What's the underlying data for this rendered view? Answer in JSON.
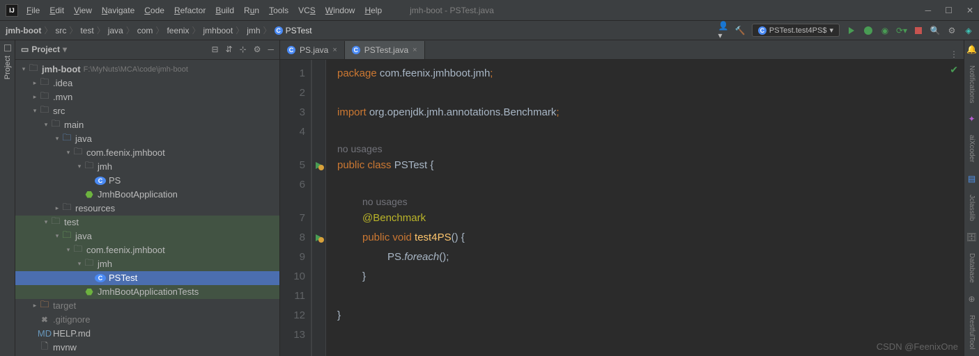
{
  "titlebar": {
    "menu": [
      "File",
      "Edit",
      "View",
      "Navigate",
      "Code",
      "Refactor",
      "Build",
      "Run",
      "Tools",
      "VCS",
      "Window",
      "Help"
    ],
    "title": "jmh-boot - PSTest.java"
  },
  "breadcrumb": [
    "jmh-boot",
    "src",
    "test",
    "java",
    "com",
    "feenix",
    "jmhboot",
    "jmh",
    "PSTest"
  ],
  "runConfig": "PSTest.test4PS$",
  "projectPanel": {
    "title": "Project",
    "root": "jmh-boot",
    "rootPath": "F:\\MyNuts\\MCA\\code\\jmh-boot",
    "nodes": {
      "idea": ".idea",
      "mvn": ".mvn",
      "src": "src",
      "main": "main",
      "java1": "java",
      "pkg1": "com.feenix.jmhboot",
      "jmh1": "jmh",
      "ps": "PS",
      "app1": "JmhBootApplication",
      "res": "resources",
      "test": "test",
      "java2": "java",
      "pkg2": "com.feenix.jmhboot",
      "jmh2": "jmh",
      "pstest": "PSTest",
      "app2": "JmhBootApplicationTests",
      "target": "target",
      "git": ".gitignore",
      "help": "HELP.md",
      "mvnw": "mvnw"
    }
  },
  "tabs": [
    {
      "label": "PS.java",
      "active": false
    },
    {
      "label": "PSTest.java",
      "active": true
    }
  ],
  "code": {
    "l1a": "package ",
    "l1b": "com.feenix.jmhboot.jmh",
    "l3a": "import ",
    "l3b": "org.openjdk.jmh.annotations.Benchmark",
    "h1": "no usages",
    "l5a": "public class ",
    "l5b": "PSTest",
    "l5c": " {",
    "h2": "no usages",
    "l7": "@Benchmark",
    "l8a": "public void ",
    "l8b": "test4PS",
    "l8c": "() {",
    "l9a": "PS.",
    "l9b": "foreach",
    "l9c": "();",
    "l10": "}",
    "l12": "}"
  },
  "lineNums": [
    "1",
    "2",
    "3",
    "4",
    "5",
    "6",
    "7",
    "8",
    "9",
    "10",
    "11",
    "12",
    "13"
  ],
  "sidetabs": {
    "left": "Project",
    "r1": "Notifications",
    "r2": "aiXcoder",
    "r3": "Jclasslib",
    "r4": "Database",
    "r5": "RestfulTool"
  },
  "watermark": "CSDN @FeenixOne"
}
